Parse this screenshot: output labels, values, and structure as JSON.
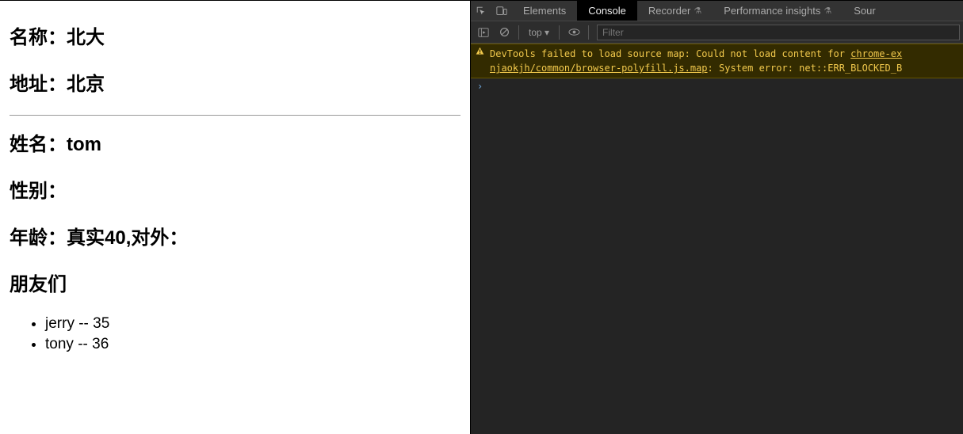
{
  "page": {
    "school_name_label": "名称：",
    "school_name_value": "北大",
    "address_label": "地址：",
    "address_value": "北京",
    "name_label": "姓名：",
    "name_value": "tom",
    "gender_label": "性别：",
    "gender_value": "",
    "age_label": "年龄：",
    "age_value": "真实40,对外：",
    "friends_label": "朋友们",
    "friends": [
      {
        "text": "jerry -- 35"
      },
      {
        "text": "tony -- 36"
      }
    ]
  },
  "devtools": {
    "tabs": {
      "elements": "Elements",
      "console": "Console",
      "recorder": "Recorder",
      "perf": "Performance insights",
      "sources": "Sour"
    },
    "toolbar": {
      "context": "top ▾",
      "filter_placeholder": "Filter"
    },
    "console": {
      "warn_prefix": "DevTools failed to load source map: Could not load content for ",
      "warn_link": "chrome-ex",
      "warn_line2a": "njaokjh/common/browser-polyfill.js.map",
      "warn_line2b": ": System error: net::ERR_BLOCKED_B",
      "prompt": "›"
    }
  }
}
